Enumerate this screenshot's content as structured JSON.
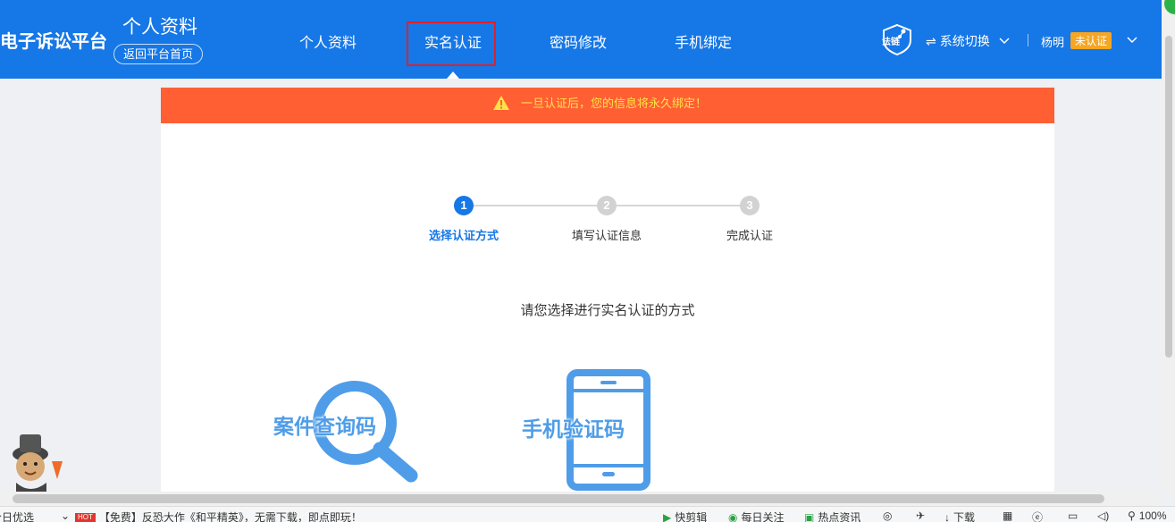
{
  "header": {
    "brand": "电子诉讼平台",
    "page_title": "个人资料",
    "home_button": "返回平台首页",
    "nav": [
      {
        "label": "个人资料"
      },
      {
        "label": "实名认证"
      },
      {
        "label": "密码修改"
      },
      {
        "label": "手机绑定"
      }
    ],
    "active_nav": "实名认证",
    "logo_text": "法链",
    "system_switch": "系统切换",
    "user": {
      "name": "杨明",
      "badge": "未认证"
    }
  },
  "alert": {
    "text": "一旦认证后，您的信息将永久绑定！",
    "icon": "warning-icon"
  },
  "steps": [
    {
      "num": "1",
      "label": "选择认证方式",
      "active": true
    },
    {
      "num": "2",
      "label": "填写认证信息",
      "active": false
    },
    {
      "num": "3",
      "label": "完成认证",
      "active": false
    }
  ],
  "prompt": "请您选择进行实名认证的方式",
  "methods": [
    {
      "label": "案件查询码",
      "icon": "magnifier-icon"
    },
    {
      "label": "手机验证码",
      "icon": "phone-icon"
    }
  ],
  "statusbar": {
    "left": "今日优选",
    "hot_badge": "HOT",
    "news": "【免费】反恐大作《和平精英》，无需下载，即点即玩！",
    "items": [
      "快剪辑",
      "每日关注",
      "热点资讯",
      "下载"
    ],
    "zoom": "100%"
  },
  "colors": {
    "header": "#1677e6",
    "alert": "#ff5f33",
    "accent": "#1677e6",
    "method": "#4f9de8",
    "badge": "#f5a623"
  }
}
